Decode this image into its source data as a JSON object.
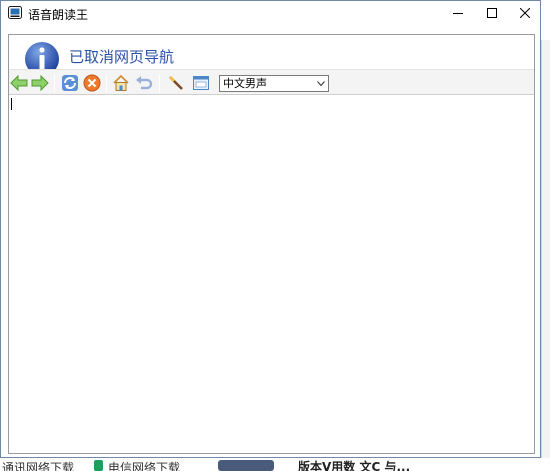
{
  "window": {
    "title": "语音朗读王",
    "minimize_icon": "minimize-icon",
    "maximize_icon": "maximize-icon",
    "close_icon": "close-icon"
  },
  "banner": {
    "icon": "info-icon",
    "message": "已取消网页导航"
  },
  "toolbar": {
    "buttons": [
      {
        "name": "back",
        "icon": "arrow-left-icon"
      },
      {
        "name": "forward",
        "icon": "arrow-right-icon"
      },
      {
        "name": "refresh",
        "icon": "refresh-icon"
      },
      {
        "name": "stop",
        "icon": "stop-icon"
      },
      {
        "name": "home",
        "icon": "home-icon"
      },
      {
        "name": "undo",
        "icon": "undo-icon"
      },
      {
        "name": "tool",
        "icon": "wand-icon"
      },
      {
        "name": "window",
        "icon": "window-icon"
      }
    ],
    "voice_selected": "中文男声"
  },
  "editor": {
    "value": ""
  },
  "background": {
    "bottom_items": [
      "通讯网络下载",
      "电信网络下载",
      "版本V用数 文C 与..."
    ]
  },
  "colors": {
    "accent": "#2a52a8",
    "border": "#6f8aa8"
  }
}
